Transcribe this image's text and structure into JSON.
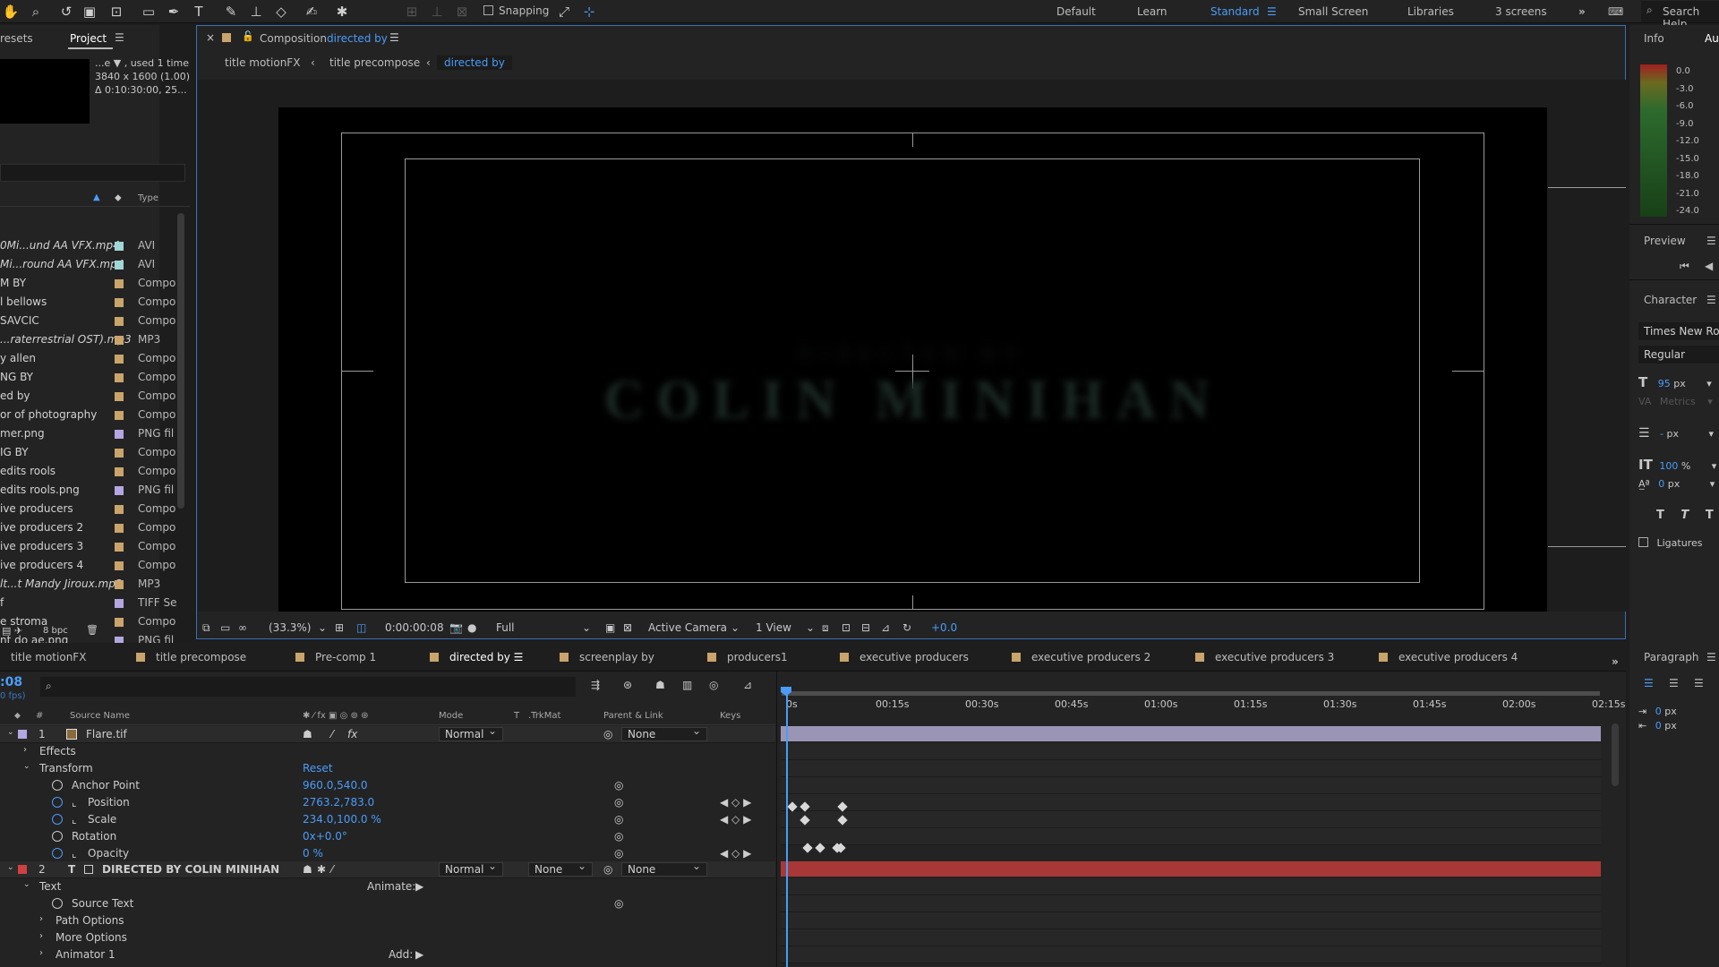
{
  "toolbar": {
    "snapping_label": "Snapping",
    "workspaces": [
      {
        "label": "Default",
        "active": false
      },
      {
        "label": "Learn",
        "active": false
      },
      {
        "label": "Standard",
        "active": true
      },
      {
        "label": "Small Screen",
        "active": false
      },
      {
        "label": "Libraries",
        "active": false
      },
      {
        "label": "3 screens",
        "active": false
      }
    ],
    "search_help": "Search Help",
    "overflow_icon": "double-chevron-right-icon"
  },
  "project": {
    "tab_effects": "resets",
    "tab_project": "Project",
    "meta_name": "...e ▼ , used 1 time",
    "meta_size": "3840 x 1600 (1.00)",
    "meta_duration": "Δ 0:10:30:00, 25...",
    "col_type": "Type",
    "bpc": "8 bpc",
    "items": [
      {
        "name": "0Mi...und AA VFX.mp4",
        "italic": true,
        "color": "#9fd6d6",
        "type": "AVI"
      },
      {
        "name": "Mi...round AA VFX.mp4",
        "italic": true,
        "color": "#9fd6d6",
        "type": "AVI"
      },
      {
        "name": "M BY",
        "italic": false,
        "color": "#c9a46b",
        "type": "Compo"
      },
      {
        "name": "l bellows",
        "italic": false,
        "color": "#c9a46b",
        "type": "Compo"
      },
      {
        "name": "SAVCIC",
        "italic": false,
        "color": "#c9a46b",
        "type": "Compo"
      },
      {
        "name": "...raterrestrial OST).mp3",
        "italic": true,
        "color": "#c9a46b",
        "type": "MP3"
      },
      {
        "name": "y allen",
        "italic": false,
        "color": "#c9a46b",
        "type": "Compo"
      },
      {
        "name": "NG BY",
        "italic": false,
        "color": "#c9a46b",
        "type": "Compo"
      },
      {
        "name": "ed by",
        "italic": false,
        "color": "#c9a46b",
        "type": "Compo"
      },
      {
        "name": "or of photography",
        "italic": false,
        "color": "#c9a46b",
        "type": "Compo"
      },
      {
        "name": "mer.png",
        "italic": false,
        "color": "#b4a6e0",
        "type": "PNG fil"
      },
      {
        "name": "IG BY",
        "italic": false,
        "color": "#c9a46b",
        "type": "Compo"
      },
      {
        "name": "edits rools",
        "italic": false,
        "color": "#c9a46b",
        "type": "Compo"
      },
      {
        "name": "edits rools.png",
        "italic": false,
        "color": "#b4a6e0",
        "type": "PNG fil"
      },
      {
        "name": "ive producers",
        "italic": false,
        "color": "#c9a46b",
        "type": "Compo"
      },
      {
        "name": "ive producers 2",
        "italic": false,
        "color": "#c9a46b",
        "type": "Compo"
      },
      {
        "name": "ive producers 3",
        "italic": false,
        "color": "#c9a46b",
        "type": "Compo"
      },
      {
        "name": "ive producers 4",
        "italic": false,
        "color": "#c9a46b",
        "type": "Compo"
      },
      {
        "name": "lt...t Mandy Jiroux.mp3",
        "italic": true,
        "color": "#c9a46b",
        "type": "MP3"
      },
      {
        "name": "f",
        "italic": false,
        "color": "#b4a6e0",
        "type": "TIFF Se"
      },
      {
        "name": "e stroma",
        "italic": false,
        "color": "#c9a46b",
        "type": "Compo"
      },
      {
        "name": "nt do ae.png",
        "italic": false,
        "color": "#b4a6e0",
        "type": "PNG fil"
      }
    ]
  },
  "viewer": {
    "tab_prefix": "Composition",
    "tab_name": "directed by",
    "breadcrumbs": [
      "title motionFX",
      "title precompose",
      "directed by"
    ],
    "comp_text": "COLIN MINIHAN",
    "comp_subtext": "DIRECTED BY",
    "zoom": "(33.3%)",
    "timecode": "0:00:00:08",
    "resolution": "Full",
    "camera": "Active Camera",
    "views": "1 View",
    "exposure": "+0.0"
  },
  "right_panel": {
    "tab_info": "Info",
    "tab_audio": "Au",
    "db_labels": [
      "0.0",
      "-3.0",
      "-6.0",
      "-9.0",
      "-12.0",
      "-15.0",
      "-18.0",
      "-21.0",
      "-24.0"
    ],
    "preview_label": "Preview",
    "character_label": "Character",
    "font": "Times New Roman",
    "style": "Regular",
    "font_size": "95",
    "font_size_unit": "px",
    "kerning": "Metrics",
    "leading": "-",
    "leading_unit": "px",
    "vscale": "100",
    "vscale_unit": "%",
    "baseline": "0",
    "baseline_unit": "px",
    "ligatures_label": "Ligatures",
    "paragraph_label": "Paragraph",
    "para_indent_1": "0",
    "para_indent_2": "0",
    "para_unit": "px"
  },
  "timeline": {
    "tabs": [
      {
        "label": "title motionFX",
        "active": false
      },
      {
        "label": "title precompose",
        "active": false
      },
      {
        "label": "Pre-comp 1",
        "active": false
      },
      {
        "label": "directed by",
        "active": true
      },
      {
        "label": "screenplay by",
        "active": false
      },
      {
        "label": "producers1",
        "active": false
      },
      {
        "label": "executive producers",
        "active": false
      },
      {
        "label": "executive producers 2",
        "active": false
      },
      {
        "label": "executive producers 3",
        "active": false
      },
      {
        "label": "executive producers 4",
        "active": false
      }
    ],
    "timecode": ":08",
    "fps": "0 fps)",
    "columns": {
      "num": "#",
      "source": "Source Name",
      "mode": "Mode",
      "t": "T",
      "trkmat": ".TrkMat",
      "parent": "Parent & Link",
      "keys": "Keys"
    },
    "ruler": [
      "0s",
      "00:15s",
      "00:30s",
      "00:45s",
      "01:00s",
      "01:15s",
      "01:30s",
      "01:45s",
      "02:00s",
      "02:15s"
    ],
    "layer1": {
      "num": "1",
      "name": "Flare.tif",
      "label_color": "#b4a6e0",
      "mode": "Normal",
      "parent": "None",
      "effects": "Effects",
      "transform": "Transform",
      "reset": "Reset",
      "props": [
        {
          "name": "Anchor Point",
          "value": "960.0,540.0",
          "graph": false
        },
        {
          "name": "Position",
          "value": "2763.2,783.0",
          "graph": true
        },
        {
          "name": "Scale",
          "value": "234.0,100.0 %",
          "graph": true
        },
        {
          "name": "Rotation",
          "value": "0x+0.0°",
          "graph": false
        },
        {
          "name": "Opacity",
          "value": "0 %",
          "graph": true
        }
      ]
    },
    "layer2": {
      "num": "2",
      "name": "DIRECTED BY COLIN MINIHAN",
      "label_color": "#d04040",
      "mode": "Normal",
      "trkmat": "None",
      "parent": "None",
      "text_group": "Text",
      "animate_label": "Animate:",
      "source_text": "Source Text",
      "path_options": "Path Options",
      "more_options": "More Options",
      "animator": "Animator 1",
      "add_label": "Add:"
    }
  }
}
